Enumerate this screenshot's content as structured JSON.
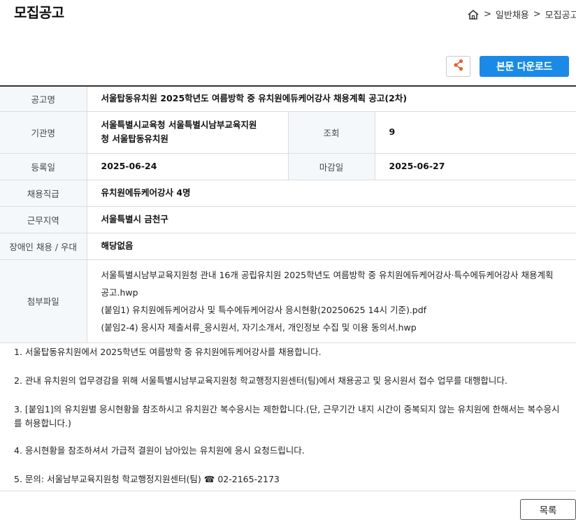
{
  "page": {
    "title": "모집공고"
  },
  "breadcrumb": {
    "sep1": ">",
    "item1": "일반채용",
    "sep2": ">",
    "item2": "모집공고"
  },
  "actions": {
    "download_label": "본문 다운로드",
    "list_label": "목록"
  },
  "info": {
    "title_label": "공고명",
    "title_value": "서울탑동유치원 2025학년도 여름방학 중 유치원에듀케어강사 채용계획 공고(2차)",
    "org_label": "기관명",
    "org_value_line1": "서울특별시교육청 서울특별시남부교육지원",
    "org_value_line2": "청 서울탑동유치원",
    "views_label": "조회",
    "views_value": "9",
    "reg_label": "등록일",
    "reg_value": "2025-06-24",
    "deadline_label": "마감일",
    "deadline_value": "2025-06-27",
    "position_label": "채용직급",
    "position_value": "유치원에듀케어강사 4명",
    "region_label": "근무지역",
    "region_value": "서울특별시 금천구",
    "disabled_label": "장애인 채용 / 우대",
    "disabled_value": "해당없음",
    "files_label": "첨부파일",
    "files": [
      "서울특별시남부교육지원청 관내 16개 공립유치원 2025학년도 여름방학 중 유치원에듀케어강사·특수에듀케어강사 채용계획 공고.hwp",
      "(붙임1) 유치원에듀케어강사 및 특수에듀케어강사 응시현황(20250625 14시 기준).pdf",
      "(붙임2-4) 응시자 제출서류_응시원서, 자기소개서, 개인정보 수집 및 이용 동의서.hwp"
    ]
  },
  "content": {
    "p1": "1. 서울탑동유치원에서 2025학년도 여름방학 중 유치원에듀케어강사를 채용합니다.",
    "p2": "2. 관내 유치원의 업무경감을 위해 서울특별시남부교육지원청 학교행정지원센터(팀)에서 채용공고 및 응시원서 접수 업무를 대행합니다.",
    "p3": "3. [붙임1]의 유치원별 응시현황을 참조하시고 유치원간 복수응시는 제한합니다.(단, 근무기간 내지 시간이 중복되지 않는 유치원에 한해서는 복수응시를 허용합니다.)",
    "p4": "4. 응시현황을 참조하셔서 가급적 결원이 남아있는 유치원에 응시 요청드립니다.",
    "p5": "5. 문의: 서울남부교육지원청 학교행정지원센터(팀) ☎ 02-2165-2173"
  },
  "colors": {
    "accent": "#1a8ae6",
    "share_icon": "#e8602a",
    "header_bg": "#f5f8fb"
  }
}
